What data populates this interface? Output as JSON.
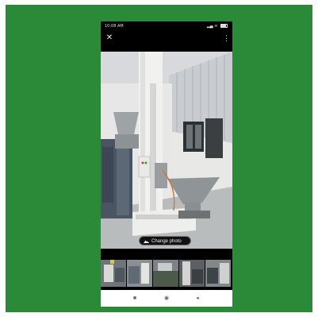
{
  "status_bar": {
    "time": "10:08 AM",
    "icons_left": [
      "whatsapp-icon",
      "sync-icon",
      "shield-icon"
    ],
    "icons_right": [
      "signal-icon",
      "wifi-icon",
      "battery-icon"
    ],
    "battery": "0%"
  },
  "viewer": {
    "close_icon": "close-icon",
    "more_icon": "more-vert-icon",
    "change_photo_label": "Change photo",
    "change_photo_icon": "image-edit-icon"
  },
  "thumbnails": [
    {
      "name": "thumb-1",
      "selected": true
    },
    {
      "name": "thumb-2",
      "selected": false
    },
    {
      "name": "thumb-3",
      "selected": false
    },
    {
      "name": "thumb-4",
      "selected": false
    },
    {
      "name": "thumb-5",
      "selected": false
    }
  ],
  "nav": {
    "recents_icon": "recents-square-icon",
    "home_icon": "home-circle-icon",
    "back_icon": "back-triangle-icon"
  },
  "colors": {
    "frame": "#2a8a37",
    "phone_bg": "#000000"
  }
}
